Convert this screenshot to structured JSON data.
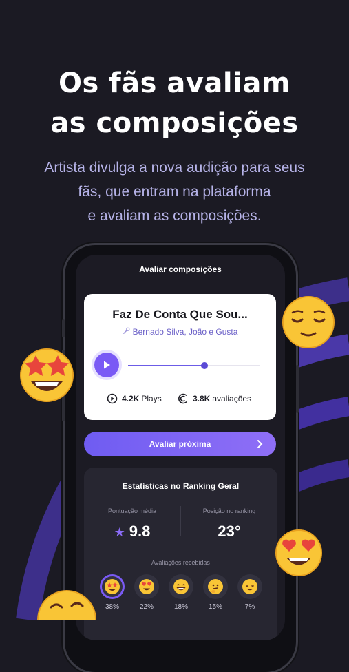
{
  "headline": {
    "line1": "Os fãs avaliam",
    "line2": "as composições"
  },
  "subtitle": {
    "line1": "Artista divulga a nova audição para seus",
    "line2": "fãs, que entram na plataforma",
    "line3": "e avaliam as composições."
  },
  "screen": {
    "title": "Avaliar composições",
    "card": {
      "song_title": "Faz De Conta Que Sou...",
      "artists": "Bernado Silva, João e Gusta",
      "progress": 0.58,
      "plays_count": "4.2K",
      "plays_label": "Plays",
      "ratings_count": "3.8K",
      "ratings_label": "avaliações"
    },
    "next_button": "Avaliar próxima",
    "stats": {
      "title": "Estatísticas no Ranking Geral",
      "avg_label": "Pontuação média",
      "avg_value": "9.8",
      "rank_label": "Posição no ranking",
      "rank_value": "23°",
      "received_label": "Avaliações recebidas",
      "ratings": [
        {
          "emoji": "star-struck",
          "pct": "38%"
        },
        {
          "emoji": "heart-eyes",
          "pct": "22%"
        },
        {
          "emoji": "grinning",
          "pct": "18%"
        },
        {
          "emoji": "thinking",
          "pct": "15%"
        },
        {
          "emoji": "relieved",
          "pct": "7%"
        }
      ]
    }
  },
  "colors": {
    "background": "#1b1a23",
    "accent": "#7a5af5",
    "subtitle": "#b6b3e8"
  },
  "floating_emojis": [
    "star-struck",
    "relieved",
    "heart-eyes",
    "grinning-sweat"
  ]
}
